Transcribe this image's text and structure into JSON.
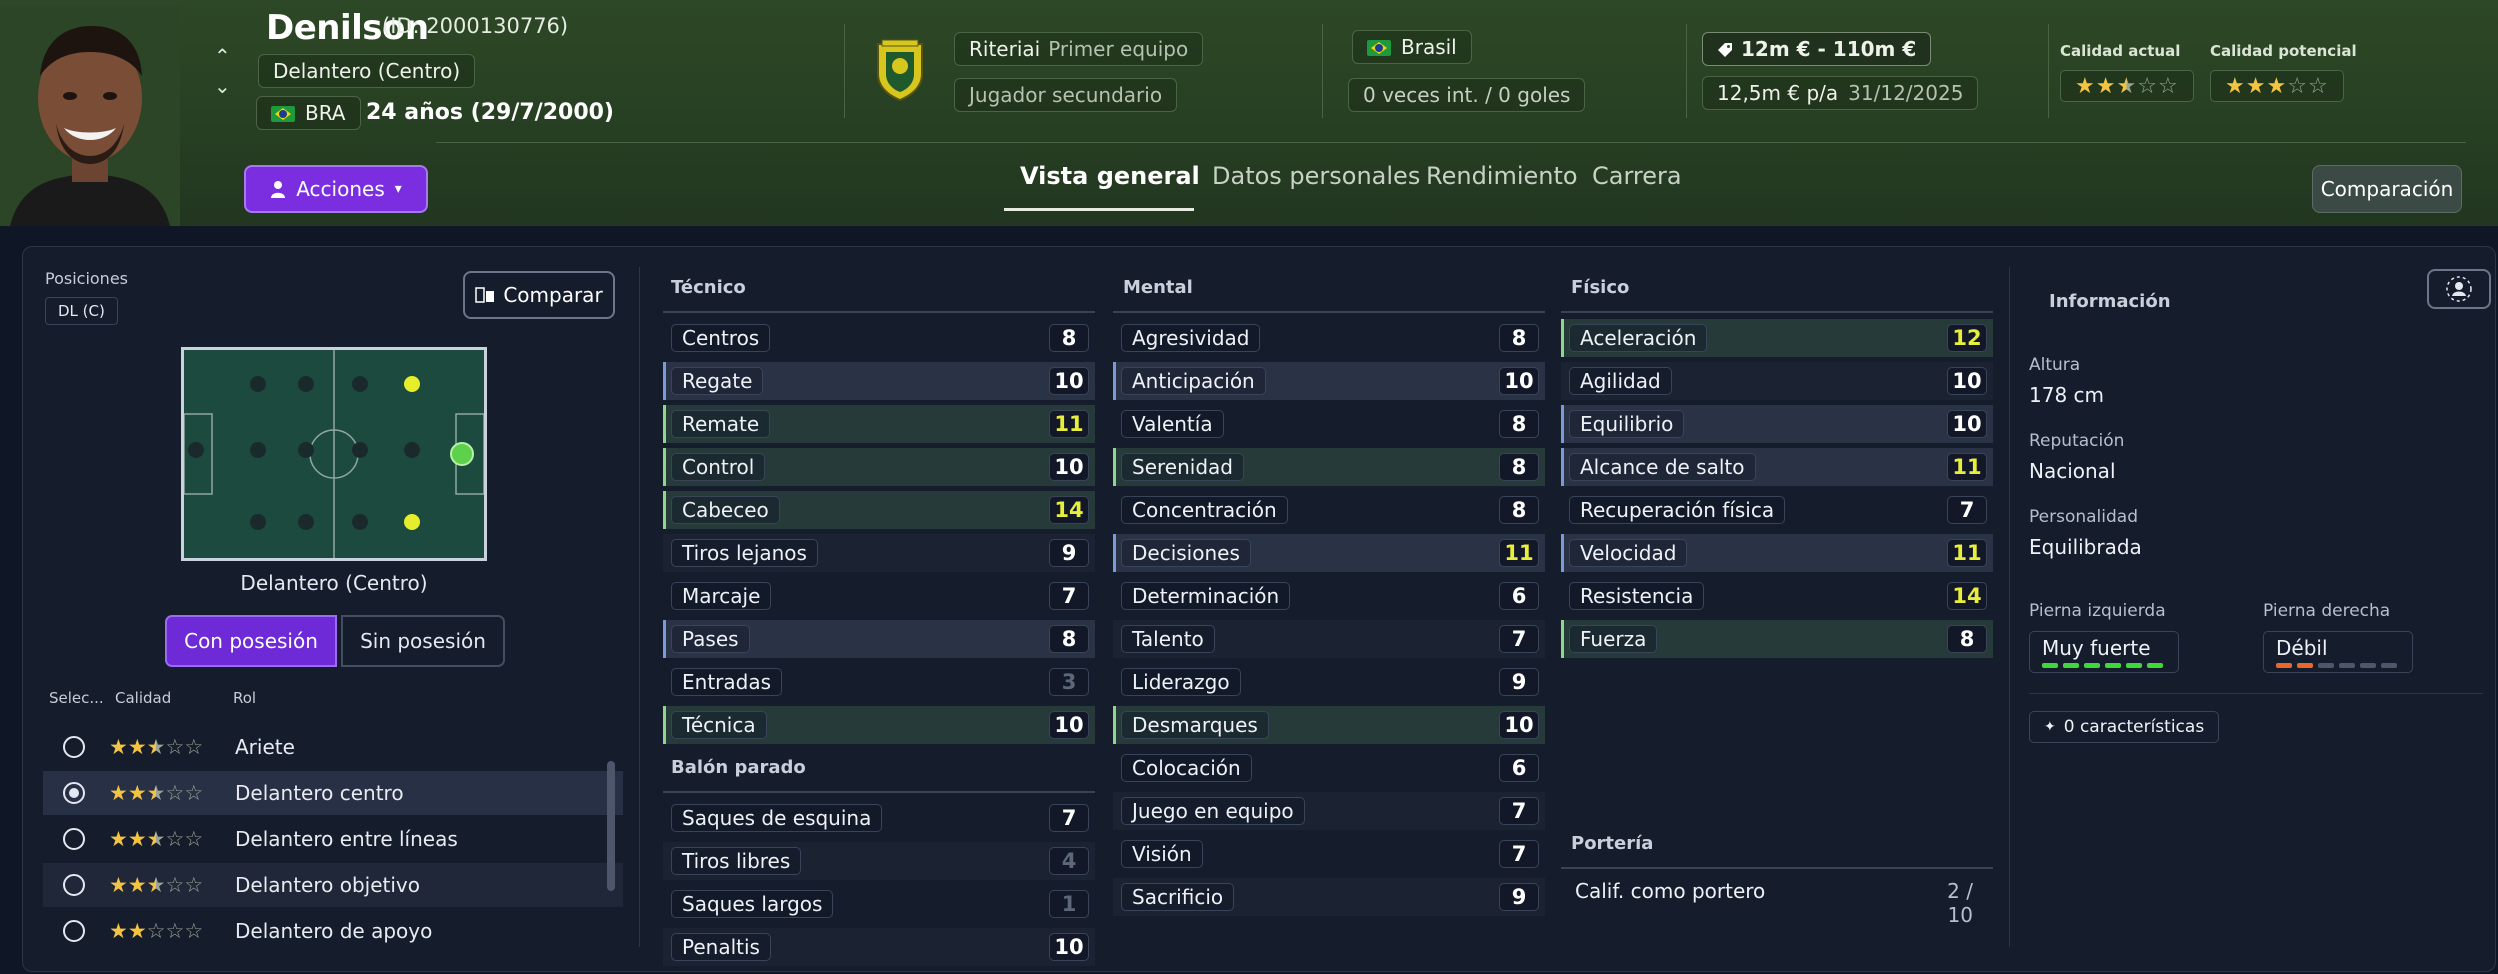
{
  "player": {
    "name": "Denilson",
    "id_text": "(ID: 2000130776)",
    "position": "Delantero (Centro)",
    "nationality_code": "BRA",
    "age_text": "24 años (29/7/2000)"
  },
  "actions_label": "Acciones",
  "club": {
    "name_label": "Riteriai",
    "squad": "Primer equipo",
    "status": "Jugador secundario"
  },
  "nation": {
    "country": "Brasil",
    "caps": "0 veces int. / 0 goles"
  },
  "value": {
    "range": "12m € - 110m €",
    "wage": "12,5m € p/a",
    "contract_end": "31/12/2025"
  },
  "quality": {
    "current_label": "Calidad actual",
    "current_stars": 2.5,
    "potential_label": "Calidad potencial",
    "potential_stars": 3
  },
  "tabs": [
    "Vista general",
    "Datos personales",
    "Rendimiento",
    "Carrera"
  ],
  "compare_top_label": "Comparación",
  "positions": {
    "label": "Posiciones",
    "tag": "DL (C)",
    "compare_label": "Comparar",
    "pitch_caption": "Delantero (Centro)",
    "in_possession": "Con posesión",
    "out_possession": "Sin posesión"
  },
  "roles": {
    "headers": [
      "Selec...",
      "Calidad",
      "Rol"
    ],
    "items": [
      {
        "name": "Ariete",
        "stars": 2.5,
        "selected": false
      },
      {
        "name": "Delantero centro",
        "stars": 2.5,
        "selected": true
      },
      {
        "name": "Delantero entre líneas",
        "stars": 2.5,
        "selected": false
      },
      {
        "name": "Delantero objetivo",
        "stars": 2.5,
        "selected": false
      },
      {
        "name": "Delantero de apoyo",
        "stars": 2,
        "selected": false
      }
    ]
  },
  "tecnico": {
    "title": "Técnico",
    "attrs": [
      {
        "name": "Centros",
        "value": "8",
        "hl": "",
        "vc": ""
      },
      {
        "name": "Regate",
        "value": "10",
        "hl": "blue",
        "vc": ""
      },
      {
        "name": "Remate",
        "value": "11",
        "hl": "green",
        "vc": "yellow"
      },
      {
        "name": "Control",
        "value": "10",
        "hl": "green",
        "vc": ""
      },
      {
        "name": "Cabeceo",
        "value": "14",
        "hl": "green",
        "vc": "yellow"
      },
      {
        "name": "Tiros lejanos",
        "value": "9",
        "hl": "stripe",
        "vc": ""
      },
      {
        "name": "Marcaje",
        "value": "7",
        "hl": "",
        "vc": ""
      },
      {
        "name": "Pases",
        "value": "8",
        "hl": "blue",
        "vc": ""
      },
      {
        "name": "Entradas",
        "value": "3",
        "hl": "",
        "vc": "dim"
      },
      {
        "name": "Técnica",
        "value": "10",
        "hl": "green",
        "vc": ""
      }
    ]
  },
  "balon_parado": {
    "title": "Balón parado",
    "attrs": [
      {
        "name": "Saques de esquina",
        "value": "7",
        "hl": "",
        "vc": ""
      },
      {
        "name": "Tiros libres",
        "value": "4",
        "hl": "stripe",
        "vc": "dim"
      },
      {
        "name": "Saques largos",
        "value": "1",
        "hl": "",
        "vc": "dim"
      },
      {
        "name": "Penaltis",
        "value": "10",
        "hl": "stripe",
        "vc": ""
      }
    ]
  },
  "mental": {
    "title": "Mental",
    "attrs": [
      {
        "name": "Agresividad",
        "value": "8",
        "hl": "",
        "vc": ""
      },
      {
        "name": "Anticipación",
        "value": "10",
        "hl": "blue",
        "vc": ""
      },
      {
        "name": "Valentía",
        "value": "8",
        "hl": "",
        "vc": ""
      },
      {
        "name": "Serenidad",
        "value": "8",
        "hl": "green",
        "vc": ""
      },
      {
        "name": "Concentración",
        "value": "8",
        "hl": "",
        "vc": ""
      },
      {
        "name": "Decisiones",
        "value": "11",
        "hl": "blue",
        "vc": "yellow"
      },
      {
        "name": "Determinación",
        "value": "6",
        "hl": "",
        "vc": ""
      },
      {
        "name": "Talento",
        "value": "7",
        "hl": "stripe",
        "vc": ""
      },
      {
        "name": "Liderazgo",
        "value": "9",
        "hl": "",
        "vc": ""
      },
      {
        "name": "Desmarques",
        "value": "10",
        "hl": "green",
        "vc": ""
      },
      {
        "name": "Colocación",
        "value": "6",
        "hl": "",
        "vc": ""
      },
      {
        "name": "Juego en equipo",
        "value": "7",
        "hl": "stripe",
        "vc": ""
      },
      {
        "name": "Visión",
        "value": "7",
        "hl": "",
        "vc": ""
      },
      {
        "name": "Sacrificio",
        "value": "9",
        "hl": "stripe",
        "vc": ""
      }
    ]
  },
  "fisico": {
    "title": "Físico",
    "attrs": [
      {
        "name": "Aceleración",
        "value": "12",
        "hl": "green",
        "vc": "yellow"
      },
      {
        "name": "Agilidad",
        "value": "10",
        "hl": "stripe",
        "vc": ""
      },
      {
        "name": "Equilibrio",
        "value": "10",
        "hl": "blue",
        "vc": ""
      },
      {
        "name": "Alcance de salto",
        "value": "11",
        "hl": "blue",
        "vc": "yellow"
      },
      {
        "name": "Recuperación física",
        "value": "7",
        "hl": "",
        "vc": ""
      },
      {
        "name": "Velocidad",
        "value": "11",
        "hl": "blue",
        "vc": "yellow"
      },
      {
        "name": "Resistencia",
        "value": "14",
        "hl": "",
        "vc": "yellow"
      },
      {
        "name": "Fuerza",
        "value": "8",
        "hl": "green",
        "vc": ""
      }
    ]
  },
  "porteria": {
    "title": "Portería",
    "label": "Calif. como portero",
    "value": "2 / 10"
  },
  "info": {
    "title": "Información",
    "height_label": "Altura",
    "height": "178 cm",
    "reputation_label": "Reputación",
    "reputation": "Nacional",
    "personality_label": "Personalidad",
    "personality": "Equilibrada",
    "left_foot_label": "Pierna izquierda",
    "left_foot": "Muy fuerte",
    "right_foot_label": "Pierna derecha",
    "right_foot": "Débil",
    "characteristics": "0 características"
  },
  "colors": {
    "accent_purple": "#7b2ee0",
    "highlight_yellow": "#e8ee3c",
    "header_green": "#2d4826"
  }
}
